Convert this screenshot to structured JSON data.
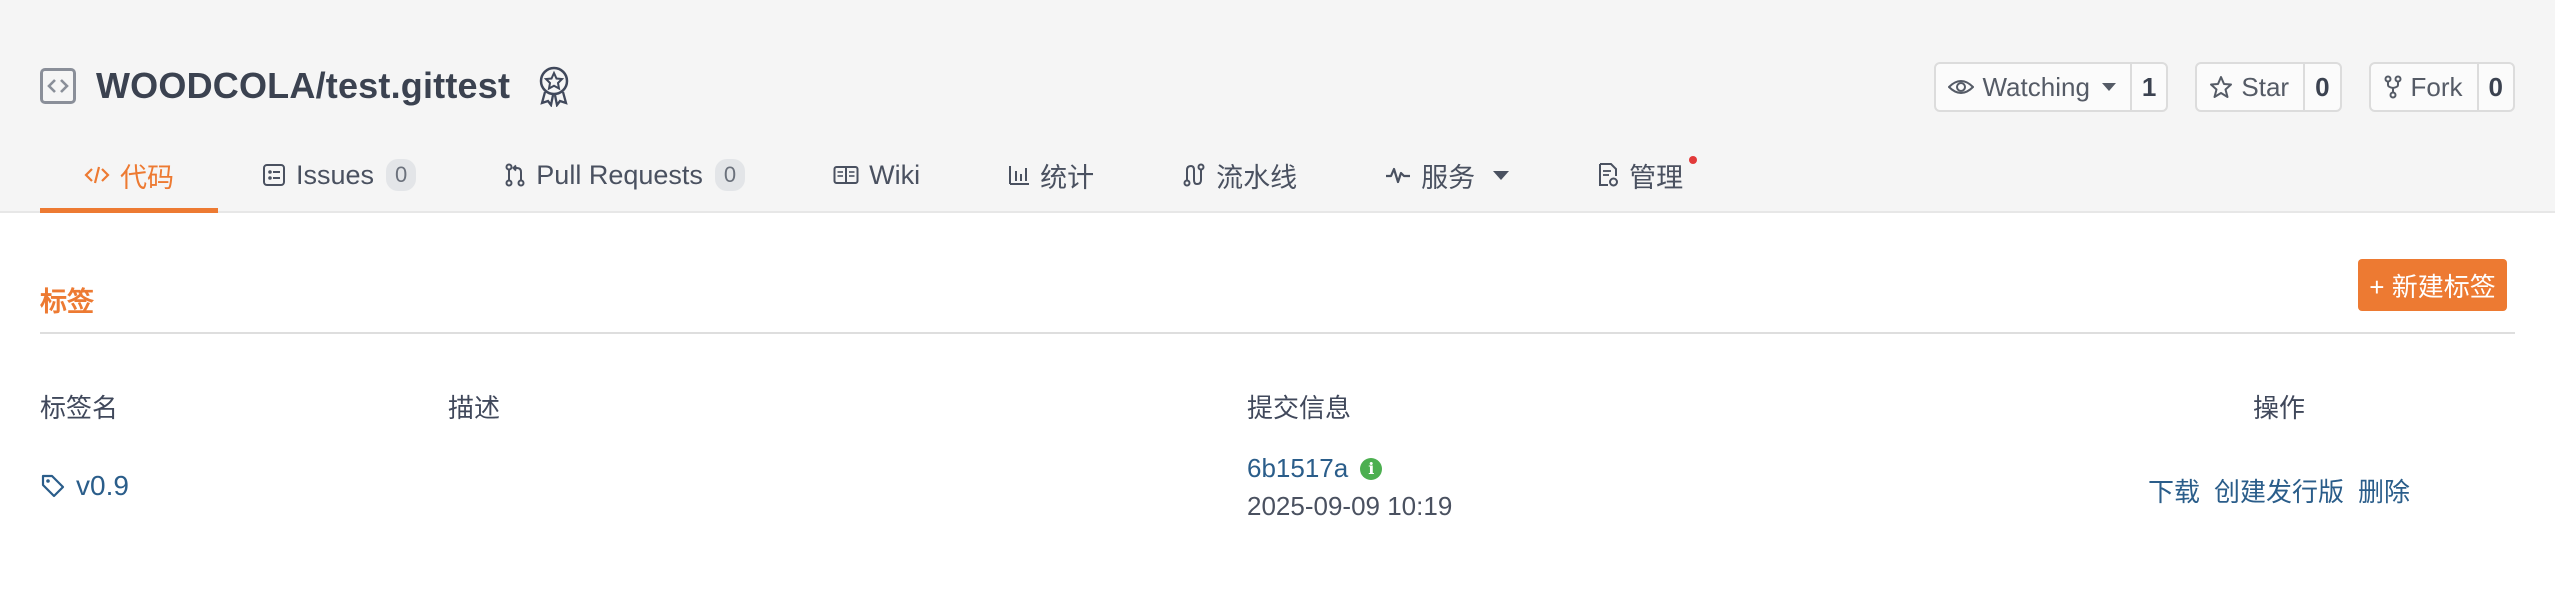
{
  "repo": {
    "name": "WOODCOLA/test.gittest",
    "watch_label": "Watching",
    "watch_count": "1",
    "star_label": "Star",
    "star_count": "0",
    "fork_label": "Fork",
    "fork_count": "0"
  },
  "tabs": [
    {
      "label": "代码",
      "icon": "code-icon",
      "active": true
    },
    {
      "label": "Issues",
      "count": "0",
      "icon": "issues-icon"
    },
    {
      "label": "Pull Requests",
      "count": "0",
      "icon": "pull-request-icon"
    },
    {
      "label": "Wiki",
      "icon": "book-icon"
    },
    {
      "label": "统计",
      "icon": "bar-chart-icon"
    },
    {
      "label": "流水线",
      "icon": "pipeline-icon"
    },
    {
      "label": "服务",
      "icon": "pulse-icon"
    },
    {
      "label": "管理",
      "icon": "document-settings-icon"
    }
  ],
  "section": {
    "title": "标签",
    "new_button": "+ 新建标签"
  },
  "table": {
    "headers": [
      "标签名",
      "描述",
      "提交信息",
      "操作"
    ],
    "rows": [
      {
        "tag": "v0.9",
        "description": "",
        "commit_hash": "6b1517a",
        "commit_date": "2025-09-09 10:19",
        "actions": [
          "下载",
          "创建发行版",
          "删除"
        ]
      }
    ]
  },
  "colors": {
    "accent": "#ed7a32",
    "link": "#2a5d8a",
    "header_bg": "#f5f5f5",
    "verified": "#4caf50",
    "notification": "#e23a3a"
  }
}
